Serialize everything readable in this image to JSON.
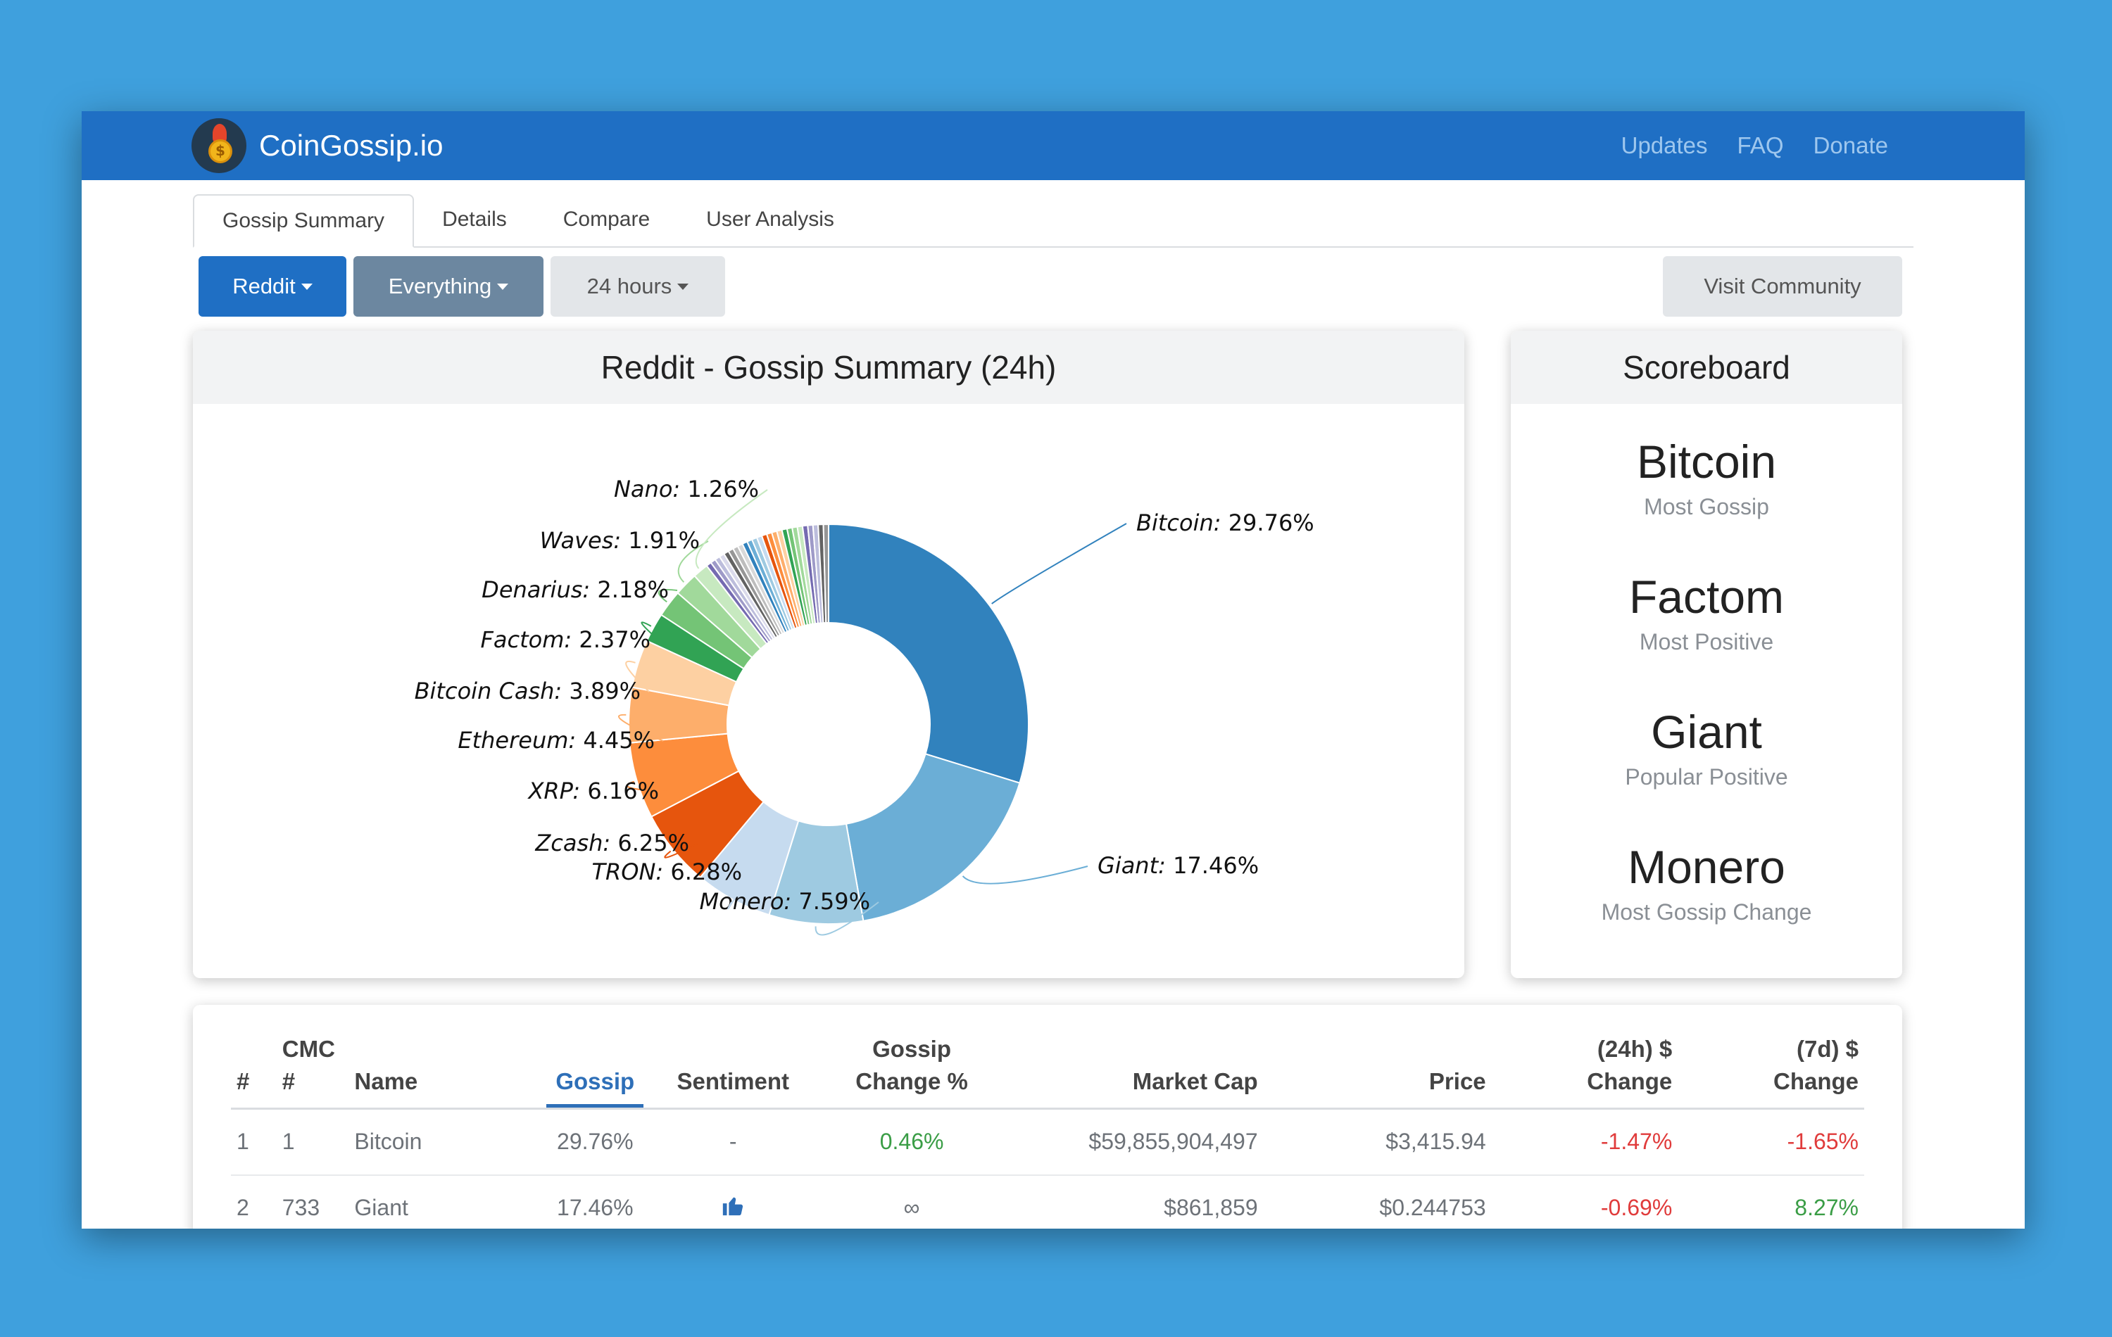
{
  "app": {
    "name": "CoinGossip.io"
  },
  "nav": {
    "links": [
      "Updates",
      "FAQ",
      "Donate"
    ]
  },
  "tabs": [
    "Gossip Summary",
    "Details",
    "Compare",
    "User Analysis"
  ],
  "filters": {
    "source": "Reddit",
    "scope": "Everything",
    "period": "24 hours"
  },
  "visit_label": "Visit Community",
  "chart_card": {
    "title": "Reddit - Gossip Summary (24h)"
  },
  "chart_data": {
    "type": "pie",
    "title": "Reddit - Gossip Summary (24h)",
    "donut": true,
    "slices": [
      {
        "label": "Bitcoin",
        "value": 29.76,
        "color": "#3182bd"
      },
      {
        "label": "Giant",
        "value": 17.46,
        "color": "#6baed6"
      },
      {
        "label": "Monero",
        "value": 7.59,
        "color": "#9ecae1"
      },
      {
        "label": "TRON",
        "value": 6.28,
        "color": "#c6dbef"
      },
      {
        "label": "Zcash",
        "value": 6.25,
        "color": "#e6550d"
      },
      {
        "label": "XRP",
        "value": 6.16,
        "color": "#fd8d3c"
      },
      {
        "label": "Ethereum",
        "value": 4.45,
        "color": "#fdae6b"
      },
      {
        "label": "Bitcoin Cash",
        "value": 3.89,
        "color": "#fdd0a2"
      },
      {
        "label": "Factom",
        "value": 2.37,
        "color": "#31a354"
      },
      {
        "label": "Denarius",
        "value": 2.18,
        "color": "#74c476"
      },
      {
        "label": "Waves",
        "value": 1.91,
        "color": "#a1d99b"
      },
      {
        "label": "Nano",
        "value": 1.26,
        "color": "#c7e9c0"
      }
    ],
    "other_slice_colors": [
      "#756bb1",
      "#9e9ac8",
      "#bcbddc",
      "#dadaeb",
      "#636363",
      "#969696",
      "#bdbdbd",
      "#d9d9d9",
      "#3182bd",
      "#6baed6",
      "#9ecae1",
      "#c6dbef",
      "#e6550d",
      "#fd8d3c",
      "#fdae6b",
      "#fdd0a2",
      "#31a354",
      "#74c476",
      "#a1d99b",
      "#c7e9c0",
      "#756bb1",
      "#9e9ac8",
      "#bcbddc",
      "#636363",
      "#969696"
    ]
  },
  "scoreboard": {
    "title": "Scoreboard",
    "items": [
      {
        "name": "Bitcoin",
        "label": "Most Gossip"
      },
      {
        "name": "Factom",
        "label": "Most Positive"
      },
      {
        "name": "Giant",
        "label": "Popular Positive"
      },
      {
        "name": "Monero",
        "label": "Most Gossip Change"
      }
    ]
  },
  "table": {
    "headers": [
      "#",
      "CMC #",
      "Name",
      "Gossip",
      "Sentiment",
      "Gossip Change %",
      "Market Cap",
      "Price",
      "(24h) $ Change",
      "(7d) $ Change"
    ],
    "header_lines": {
      "gossip_change_1": "Gossip",
      "gossip_change_2": "Change %",
      "chg24_1": "(24h) $",
      "chg24_2": "Change",
      "chg7_1": "(7d) $",
      "chg7_2": "Change"
    },
    "rows": [
      {
        "rank": "1",
        "cmc": "1",
        "name": "Bitcoin",
        "gossip": "29.76%",
        "sentiment": "-",
        "gossip_change": "0.46%",
        "market_cap": "$59,855,904,497",
        "price": "$3,415.94",
        "change_24h": "-1.47%",
        "change_7d": "-1.65%"
      },
      {
        "rank": "2",
        "cmc": "733",
        "name": "Giant",
        "gossip": "17.46%",
        "sentiment_icon": "thumbs-up-icon",
        "gossip_change": "∞",
        "market_cap": "$861,859",
        "price": "$0.244753",
        "change_24h": "-0.69%",
        "change_7d": "8.27%"
      }
    ]
  }
}
